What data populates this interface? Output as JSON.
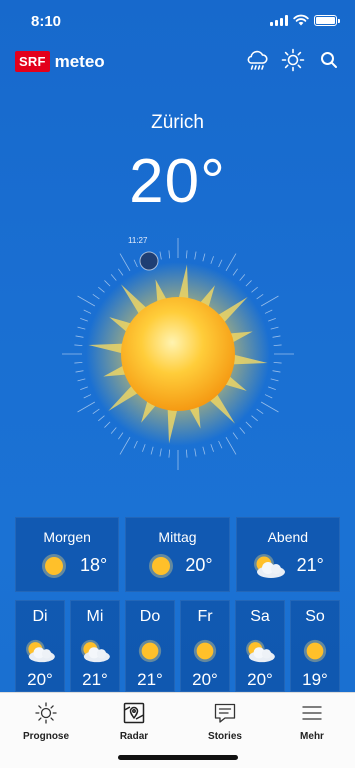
{
  "status_bar": {
    "time": "8:10"
  },
  "app": {
    "logo_srf": "SRF",
    "logo_meteo": "meteo"
  },
  "header_icons": [
    "rain-cloud-icon",
    "sun-icon",
    "search-icon"
  ],
  "location": {
    "city": "Zürich",
    "temperature": "20°"
  },
  "sun_dial": {
    "time_label": "11:27"
  },
  "day_segments": [
    {
      "label": "Morgen",
      "icon": "sun-icon",
      "temp": "18°"
    },
    {
      "label": "Mittag",
      "icon": "sun-icon",
      "temp": "20°"
    },
    {
      "label": "Abend",
      "icon": "sun-cloud-icon",
      "temp": "21°"
    }
  ],
  "forecast": [
    {
      "day": "Di",
      "icon": "sun-cloud-icon",
      "temp": "20°"
    },
    {
      "day": "Mi",
      "icon": "sun-cloud-icon",
      "temp": "21°"
    },
    {
      "day": "Do",
      "icon": "sun-icon",
      "temp": "21°"
    },
    {
      "day": "Fr",
      "icon": "sun-icon",
      "temp": "20°"
    },
    {
      "day": "Sa",
      "icon": "sun-cloud-icon",
      "temp": "20°"
    },
    {
      "day": "So",
      "icon": "sun-icon",
      "temp": "19°"
    }
  ],
  "tabs": [
    {
      "label": "Prognose",
      "icon": "sun-outline-icon"
    },
    {
      "label": "Radar",
      "icon": "map-pin-icon"
    },
    {
      "label": "Stories",
      "icon": "chat-icon"
    },
    {
      "label": "Mehr",
      "icon": "menu-icon"
    }
  ],
  "colors": {
    "background": "#1a6fd2",
    "srf_red": "#e3001b",
    "sun": "#ffc52e"
  }
}
